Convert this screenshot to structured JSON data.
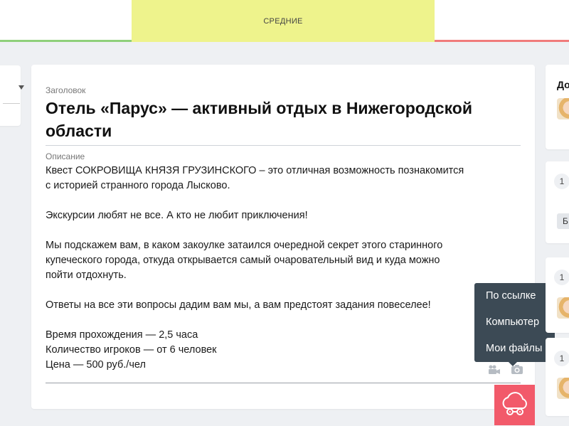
{
  "status_bar": {
    "mid_label": "СРЕДНИЕ",
    "colors": {
      "left": "#8fd07a",
      "mid": "#eef38c",
      "right": "#f07b7b"
    }
  },
  "form": {
    "title_label": "Заголовок",
    "title_value": "Отель «Парус» — активный отдых в Нижегородской области",
    "description_label": "Описание",
    "description_paragraphs": [
      "Квест СОКРОВИЩА КНЯЗЯ ГРУЗИНСКОГО – это отличная возможность познакомится\nс историей странного города Лысково.",
      "Экскурсии любят не все. А кто не любит приключения!",
      "Мы подскажем вам, в каком закоулке затаился очередной секрет этого старинного\nкупеческого города, откуда открывается самый очаровательный вид и куда можно\nпойти отдохнуть.",
      "Ответы на все эти вопросы дадим вам мы, а вам предстоят задания повеселее!",
      "Время прохождения — 2,5 часа\nКоличество игроков — от 6 человек\nЦена —  500 руб./чел"
    ],
    "media_icons": [
      "video-camera-icon",
      "photo-camera-icon"
    ]
  },
  "upload_menu": {
    "items": [
      "По ссылке",
      "Компьютер",
      "Мои файлы"
    ],
    "background": "#3c4a55"
  },
  "upload_button": {
    "icon": "cloud-upload-icon",
    "color": "#f25a6a"
  },
  "right_column": {
    "card1_title": "До",
    "card2_num": "1",
    "card2_badge": "Б",
    "card3_num": "1",
    "card4_num": "1"
  }
}
